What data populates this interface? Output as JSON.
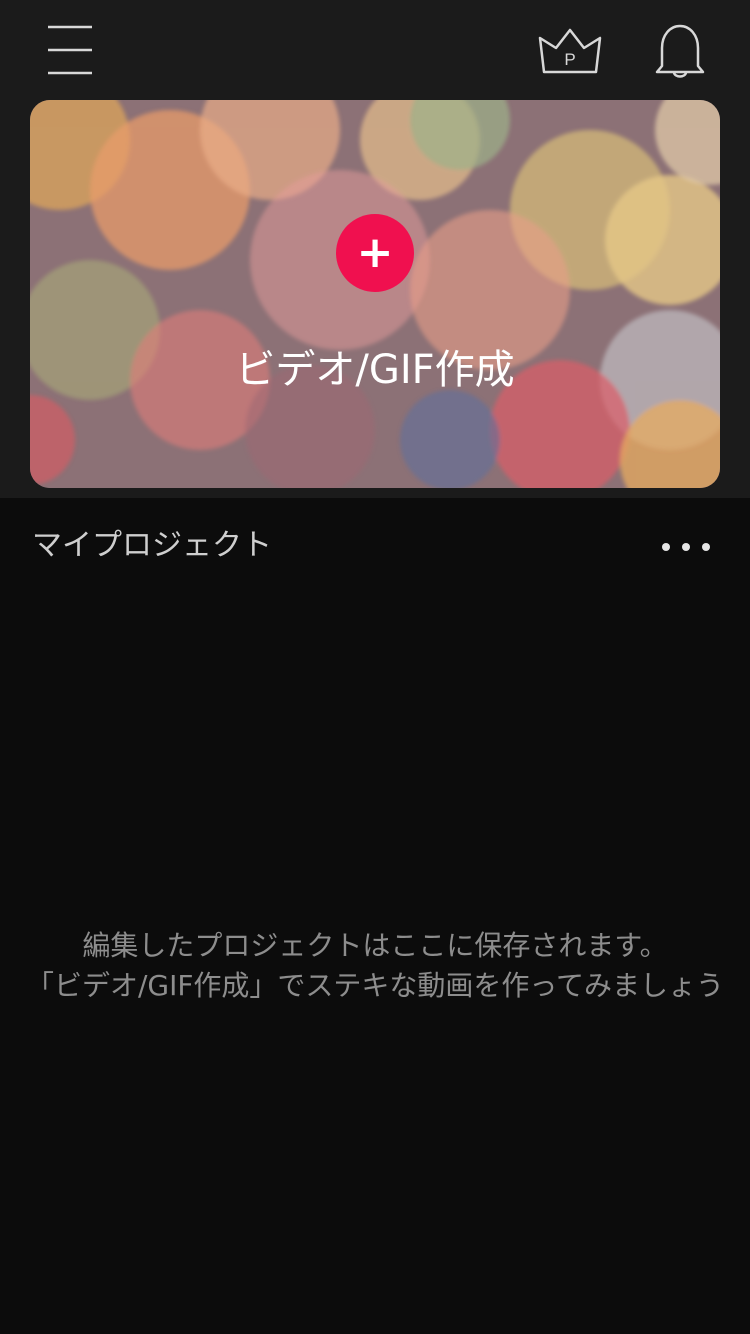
{
  "header": {
    "menu_icon": "hamburger-menu-icon",
    "premium_icon": "crown-premium-icon",
    "premium_badge": "P",
    "notification_icon": "bell-icon"
  },
  "hero": {
    "add_icon": "+",
    "title": "ビデオ/GIF作成"
  },
  "projects": {
    "title": "マイプロジェクト",
    "more_icon": "more-dots-icon",
    "empty_line1": "編集したプロジェクトはここに保存されます。",
    "empty_line2": "「ビデオ/GIF作成」でステキな動画を作ってみましょう"
  },
  "colors": {
    "accent": "#f0104f",
    "background": "#0c0c0c",
    "top_area": "#1b1b1b"
  }
}
